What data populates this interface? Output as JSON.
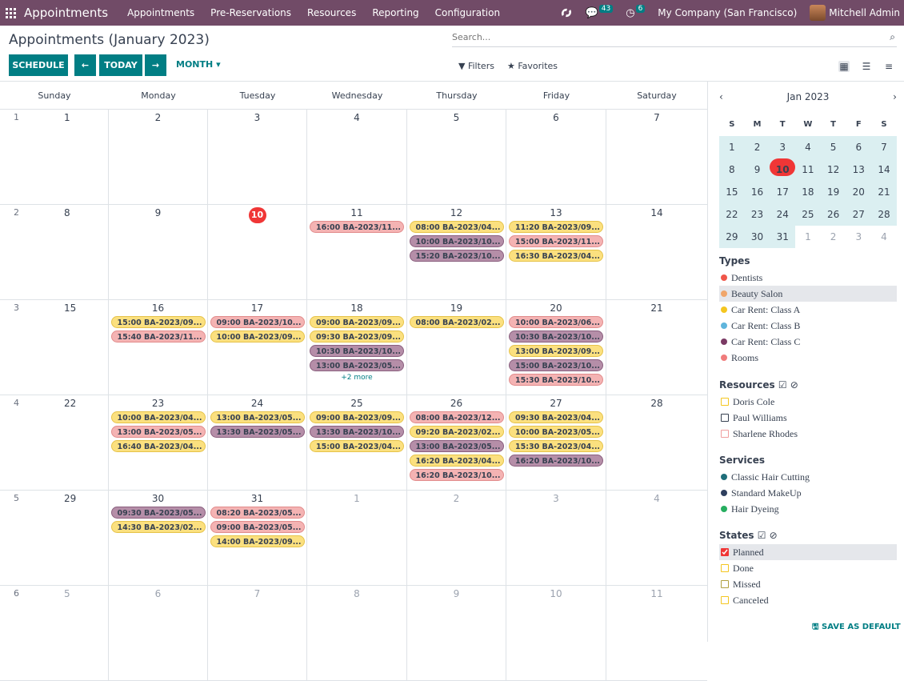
{
  "navbar": {
    "brand": "Appointments",
    "menu": [
      "Appointments",
      "Pre-Reservations",
      "Resources",
      "Reporting",
      "Configuration"
    ],
    "messages_count": "43",
    "activities_count": "6",
    "company": "My Company (San Francisco)",
    "user": "Mitchell Admin"
  },
  "control": {
    "title": "Appointments (January 2023)",
    "search_placeholder": "Search...",
    "schedule": "SCHEDULE",
    "today": "TODAY",
    "month": "MONTH",
    "filters": "Filters",
    "favorites": "Favorites"
  },
  "calendar": {
    "days": [
      "Sunday",
      "Monday",
      "Tuesday",
      "Wednesday",
      "Thursday",
      "Friday",
      "Saturday"
    ],
    "weeks": [
      {
        "wk": "1",
        "days": [
          {
            "d": "1"
          },
          {
            "d": "2"
          },
          {
            "d": "3"
          },
          {
            "d": "4"
          },
          {
            "d": "5"
          },
          {
            "d": "6"
          },
          {
            "d": "7"
          }
        ]
      },
      {
        "wk": "2",
        "days": [
          {
            "d": "8"
          },
          {
            "d": "9"
          },
          {
            "d": "10",
            "today": true
          },
          {
            "d": "11",
            "ev": [
              [
                "16:00 BA-2023/11...",
                "p"
              ]
            ]
          },
          {
            "d": "12",
            "ev": [
              [
                "08:00 BA-2023/04...",
                "y"
              ],
              [
                "10:00 BA-2023/10...",
                "m"
              ],
              [
                "15:20 BA-2023/10...",
                "m"
              ]
            ]
          },
          {
            "d": "13",
            "ev": [
              [
                "11:20 BA-2023/09...",
                "y"
              ],
              [
                "15:00 BA-2023/11...",
                "p"
              ],
              [
                "16:30 BA-2023/04...",
                "y"
              ]
            ]
          },
          {
            "d": "14"
          }
        ]
      },
      {
        "wk": "3",
        "days": [
          {
            "d": "15"
          },
          {
            "d": "16",
            "ev": [
              [
                "15:00 BA-2023/09...",
                "y"
              ],
              [
                "15:40 BA-2023/11...",
                "p"
              ]
            ]
          },
          {
            "d": "17",
            "ev": [
              [
                "09:00 BA-2023/10...",
                "p"
              ],
              [
                "10:00 BA-2023/09...",
                "y"
              ]
            ]
          },
          {
            "d": "18",
            "ev": [
              [
                "09:00 BA-2023/09...",
                "y"
              ],
              [
                "09:30 BA-2023/09...",
                "y"
              ],
              [
                "10:30 BA-2023/10...",
                "m"
              ],
              [
                "13:00 BA-2023/05...",
                "m"
              ]
            ],
            "more": "+2 more"
          },
          {
            "d": "19",
            "ev": [
              [
                "08:00 BA-2023/02...",
                "y"
              ]
            ]
          },
          {
            "d": "20",
            "ev": [
              [
                "10:00 BA-2023/06...",
                "p"
              ],
              [
                "10:30 BA-2023/10...",
                "m"
              ],
              [
                "13:00 BA-2023/09...",
                "y"
              ],
              [
                "15:00 BA-2023/10...",
                "m"
              ],
              [
                "15:30 BA-2023/10...",
                "p"
              ]
            ]
          },
          {
            "d": "21"
          }
        ]
      },
      {
        "wk": "4",
        "days": [
          {
            "d": "22"
          },
          {
            "d": "23",
            "ev": [
              [
                "10:00 BA-2023/04...",
                "y"
              ],
              [
                "13:00 BA-2023/05...",
                "p"
              ],
              [
                "16:40 BA-2023/04...",
                "y"
              ]
            ]
          },
          {
            "d": "24",
            "ev": [
              [
                "13:00 BA-2023/05...",
                "y"
              ],
              [
                "13:30 BA-2023/05...",
                "m"
              ]
            ]
          },
          {
            "d": "25",
            "ev": [
              [
                "09:00 BA-2023/09...",
                "y"
              ],
              [
                "13:30 BA-2023/10...",
                "m"
              ],
              [
                "15:00 BA-2023/04...",
                "y"
              ]
            ]
          },
          {
            "d": "26",
            "ev": [
              [
                "08:00 BA-2023/12...",
                "p"
              ],
              [
                "09:20 BA-2023/02...",
                "y"
              ],
              [
                "13:00 BA-2023/05...",
                "m"
              ],
              [
                "16:20 BA-2023/04...",
                "y"
              ],
              [
                "16:20 BA-2023/10...",
                "p"
              ]
            ]
          },
          {
            "d": "27",
            "ev": [
              [
                "09:30 BA-2023/04...",
                "y"
              ],
              [
                "10:00 BA-2023/05...",
                "y"
              ],
              [
                "15:30 BA-2023/04...",
                "y"
              ],
              [
                "16:20 BA-2023/10...",
                "m"
              ]
            ]
          },
          {
            "d": "28"
          }
        ]
      },
      {
        "wk": "5",
        "days": [
          {
            "d": "29"
          },
          {
            "d": "30",
            "ev": [
              [
                "09:30 BA-2023/05...",
                "m"
              ],
              [
                "14:30 BA-2023/02...",
                "y"
              ]
            ]
          },
          {
            "d": "31",
            "ev": [
              [
                "08:20 BA-2023/05...",
                "p"
              ],
              [
                "09:00 BA-2023/05...",
                "p"
              ],
              [
                "14:00 BA-2023/09...",
                "y"
              ]
            ]
          },
          {
            "d": "1",
            "other": true
          },
          {
            "d": "2",
            "other": true
          },
          {
            "d": "3",
            "other": true
          },
          {
            "d": "4",
            "other": true
          }
        ]
      },
      {
        "wk": "6",
        "days": [
          {
            "d": "5",
            "other": true
          },
          {
            "d": "6",
            "other": true
          },
          {
            "d": "7",
            "other": true
          },
          {
            "d": "8",
            "other": true
          },
          {
            "d": "9",
            "other": true
          },
          {
            "d": "10",
            "other": true
          },
          {
            "d": "11",
            "other": true
          }
        ]
      }
    ]
  },
  "sidebar": {
    "month_label": "Jan 2023",
    "dow": [
      "S",
      "M",
      "T",
      "W",
      "T",
      "F",
      "S"
    ],
    "mini_weeks": [
      [
        "1",
        "2",
        "3",
        "4",
        "5",
        "6",
        "7"
      ],
      [
        "8",
        "9",
        "10",
        "11",
        "12",
        "13",
        "14"
      ],
      [
        "15",
        "16",
        "17",
        "18",
        "19",
        "20",
        "21"
      ],
      [
        "22",
        "23",
        "24",
        "25",
        "26",
        "27",
        "28"
      ],
      [
        "29",
        "30",
        "31",
        "1",
        "2",
        "3",
        "4"
      ]
    ],
    "types_title": "Types",
    "types": [
      {
        "label": "Dentists",
        "color": "#f0564a"
      },
      {
        "label": "Beauty Salon",
        "color": "#f0a66a"
      },
      {
        "label": "Car Rent: Class A",
        "color": "#f4c620"
      },
      {
        "label": "Car Rent: Class B",
        "color": "#5fb5dc"
      },
      {
        "label": "Car Rent: Class C",
        "color": "#7b3a64"
      },
      {
        "label": "Rooms",
        "color": "#f07c7c"
      }
    ],
    "resources_title": "Resources",
    "resources": [
      {
        "label": "Doris Cole",
        "color": "#f4c620"
      },
      {
        "label": "Paul Williams",
        "color": "#374151"
      },
      {
        "label": "Sharlene Rhodes",
        "color": "#f0a0a0"
      }
    ],
    "services_title": "Services",
    "services": [
      {
        "label": "Classic Hair Cutting",
        "color": "#1f6e7a"
      },
      {
        "label": "Standard MakeUp",
        "color": "#2e3f5e"
      },
      {
        "label": "Hair Dyeing",
        "color": "#27ae60"
      }
    ],
    "states_title": "States",
    "states": [
      {
        "label": "Planned",
        "color": "#f03636",
        "checked": true
      },
      {
        "label": "Done",
        "color": "#f4c620"
      },
      {
        "label": "Missed",
        "color": "#b0a040"
      },
      {
        "label": "Canceled",
        "color": "#f4c620"
      }
    ],
    "save_default": "SAVE AS DEFAULT"
  }
}
